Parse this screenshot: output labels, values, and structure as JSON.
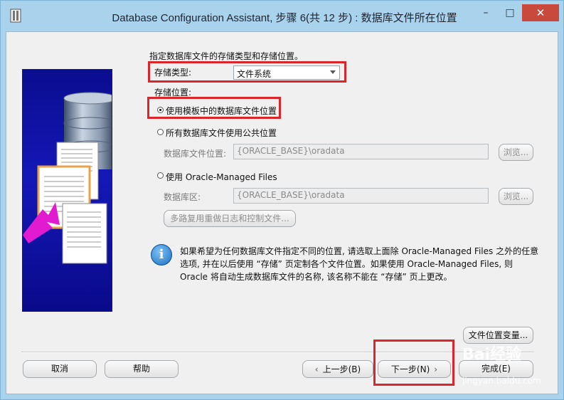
{
  "window": {
    "title": "Database Configuration Assistant, 步骤 6(共 12 步) : 数据库文件所在位置",
    "minimize_glyph": "–",
    "maximize_glyph": "□",
    "close_glyph": "✕"
  },
  "intro_text": "指定数据库文件的存储类型和存储位置。",
  "storage_type": {
    "label": "存储类型:",
    "value": "文件系统"
  },
  "storage_location": {
    "label": "存储位置:",
    "options": [
      {
        "label": "使用模板中的数据库文件位置",
        "selected": true
      },
      {
        "label": "所有数据库文件使用公共位置",
        "selected": false
      },
      {
        "label": "使用 Oracle-Managed Files",
        "selected": false
      }
    ],
    "db_file_location_label": "数据库文件位置:",
    "db_file_location_value": "{ORACLE_BASE}\\oradata",
    "db_area_label": "数据库区:",
    "db_area_value": "{ORACLE_BASE}\\oradata",
    "browse_label": "浏览...",
    "multiplex_button": "多路复用重做日志和控制文件..."
  },
  "info": {
    "icon": "info-icon",
    "line1": "如果希望为任何数据库文件指定不同的位置, 请选取上面除 Oracle-Managed Files 之外的任意",
    "line2": "选项, 并在以后使用 “存储” 页定制各个文件位置。如果使用 Oracle-Managed Files, 则",
    "line3": "Oracle 将自动生成数据库文件的名称, 该名称不能在 “存储” 页上更改。"
  },
  "buttons": {
    "file_location_vars": "文件位置变量...",
    "cancel": "取消",
    "help": "帮助",
    "back": "上一步(B)",
    "next": "下一步(N)",
    "finish": "完成(E)"
  },
  "watermark": {
    "brand": "Bai经验",
    "url": "jingyan.baidu.com"
  },
  "colors": {
    "highlight_box": "#d9262b",
    "close_button": "#c74a3d",
    "side_panel": "#1418b7"
  }
}
